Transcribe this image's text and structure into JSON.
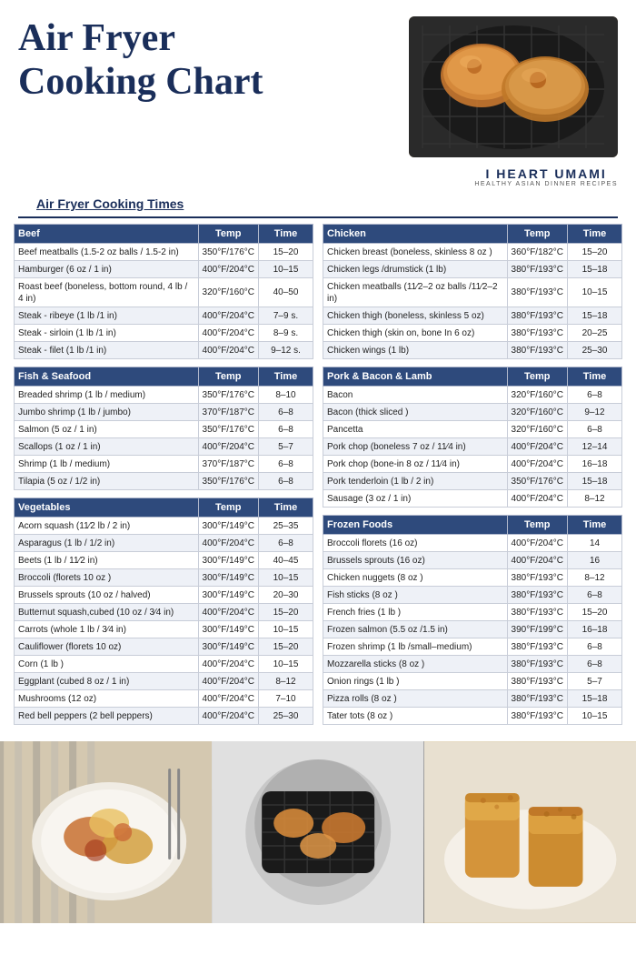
{
  "header": {
    "title_line1": "Air Fryer",
    "title_line2": "Cooking Chart"
  },
  "branding": {
    "name": "I HEART UMAMI",
    "sub": "HEALTHY ASIAN DINNER RECIPES"
  },
  "section_title": "Air Fryer Cooking Times",
  "beef": {
    "category": "Beef",
    "col_temp": "Temp",
    "col_time": "Time",
    "rows": [
      [
        "Beef meatballs (1.5-2 oz balls / 1.5-2 in)",
        "350°F/176°C",
        "15–20"
      ],
      [
        "Hamburger (6 oz / 1 in)",
        "400°F/204°C",
        "10–15"
      ],
      [
        "Roast beef (boneless, bottom round, 4 lb / 4 in)",
        "320°F/160°C",
        "40–50"
      ],
      [
        "Steak - ribeye (1 lb /1 in)",
        "400°F/204°C",
        "7–9 s."
      ],
      [
        "Steak - sirloin (1 lb /1 in)",
        "400°F/204°C",
        "8–9 s."
      ],
      [
        "Steak - filet (1 lb /1 in)",
        "400°F/204°C",
        "9–12 s."
      ]
    ]
  },
  "fish": {
    "category": "Fish & Seafood",
    "col_temp": "Temp",
    "col_time": "Time",
    "rows": [
      [
        "Breaded shrimp (1 lb / medium)",
        "350°F/176°C",
        "8–10"
      ],
      [
        "Jumbo shrimp (1 lb / jumbo)",
        "370°F/187°C",
        "6–8"
      ],
      [
        "Salmon (5 oz / 1 in)",
        "350°F/176°C",
        "6–8"
      ],
      [
        "Scallops (1 oz / 1 in)",
        "400°F/204°C",
        "5–7"
      ],
      [
        "Shrimp (1 lb / medium)",
        "370°F/187°C",
        "6–8"
      ],
      [
        "Tilapia (5 oz / 1/2 in)",
        "350°F/176°C",
        "6–8"
      ]
    ]
  },
  "vegetables": {
    "category": "Vegetables",
    "col_temp": "Temp",
    "col_time": "Time",
    "rows": [
      [
        "Acorn squash (11⁄2 lb / 2 in)",
        "300°F/149°C",
        "25–35"
      ],
      [
        "Asparagus (1 lb / 1/2 in)",
        "400°F/204°C",
        "6–8"
      ],
      [
        "Beets (1 lb / 11⁄2 in)",
        "300°F/149°C",
        "40–45"
      ],
      [
        "Broccoli (florets 10 oz )",
        "300°F/149°C",
        "10–15"
      ],
      [
        "Brussels sprouts (10 oz / halved)",
        "300°F/149°C",
        "20–30"
      ],
      [
        "Butternut squash,cubed (10 oz / 3⁄4 in)",
        "400°F/204°C",
        "15–20"
      ],
      [
        "Carrots (whole 1 lb / 3⁄4 in)",
        "300°F/149°C",
        "10–15"
      ],
      [
        "Cauliflower (florets 10 oz)",
        "300°F/149°C",
        "15–20"
      ],
      [
        "Corn (1 lb )",
        "400°F/204°C",
        "10–15"
      ],
      [
        "Eggplant (cubed 8 oz / 1 in)",
        "400°F/204°C",
        "8–12"
      ],
      [
        "Mushrooms (12 oz)",
        "400°F/204°C",
        "7–10"
      ],
      [
        "Red bell peppers (2 bell peppers)",
        "400°F/204°C",
        "25–30"
      ]
    ]
  },
  "chicken": {
    "category": "Chicken",
    "col_temp": "Temp",
    "col_time": "Time",
    "rows": [
      [
        "Chicken breast (boneless, skinless 8 oz )",
        "360°F/182°C",
        "15–20"
      ],
      [
        "Chicken legs /drumstick (1 lb)",
        "380°F/193°C",
        "15–18"
      ],
      [
        "Chicken meatballs (11⁄2–2 oz balls /11⁄2–2 in)",
        "380°F/193°C",
        "10–15"
      ],
      [
        "Chicken thigh (boneless, skinless 5 oz)",
        "380°F/193°C",
        "15–18"
      ],
      [
        "Chicken thigh (skin on, bone In 6 oz)",
        "380°F/193°C",
        "20–25"
      ],
      [
        "Chicken wings (1 lb)",
        "380°F/193°C",
        "25–30"
      ]
    ]
  },
  "pork": {
    "category": "Pork & Bacon & Lamb",
    "col_temp": "Temp",
    "col_time": "Time",
    "rows": [
      [
        "Bacon",
        "320°F/160°C",
        "6–8"
      ],
      [
        "Bacon (thick sliced )",
        "320°F/160°C",
        "9–12"
      ],
      [
        "Pancetta",
        "320°F/160°C",
        "6–8"
      ],
      [
        "Pork chop (boneless 7 oz / 11⁄4 in)",
        "400°F/204°C",
        "12–14"
      ],
      [
        "Pork chop (bone-in 8 oz / 11⁄4 in)",
        "400°F/204°C",
        "16–18"
      ],
      [
        "Pork tenderloin (1 lb / 2 in)",
        "350°F/176°C",
        "15–18"
      ],
      [
        "Sausage (3 oz / 1 in)",
        "400°F/204°C",
        "8–12"
      ]
    ]
  },
  "frozen": {
    "category": "Frozen Foods",
    "col_temp": "Temp",
    "col_time": "Time",
    "rows": [
      [
        "Broccoli florets (16 oz)",
        "400°F/204°C",
        "14"
      ],
      [
        "Brussels sprouts (16 oz)",
        "400°F/204°C",
        "16"
      ],
      [
        "Chicken nuggets (8 oz )",
        "380°F/193°C",
        "8–12"
      ],
      [
        "Fish sticks (8 oz )",
        "380°F/193°C",
        "6–8"
      ],
      [
        "French fries (1 lb )",
        "380°F/193°C",
        "15–20"
      ],
      [
        "Frozen salmon (5.5 oz /1.5 in)",
        "390°F/199°C",
        "16–18"
      ],
      [
        "Frozen shrimp (1 lb /small–medium)",
        "380°F/193°C",
        "6–8"
      ],
      [
        "Mozzarella sticks (8 oz )",
        "380°F/193°C",
        "6–8"
      ],
      [
        "Onion rings (1 lb )",
        "380°F/193°C",
        "5–7"
      ],
      [
        "Pizza rolls (8 oz )",
        "380°F/193°C",
        "15–18"
      ],
      [
        "Tater tots (8 oz )",
        "380°F/193°C",
        "10–15"
      ]
    ]
  }
}
